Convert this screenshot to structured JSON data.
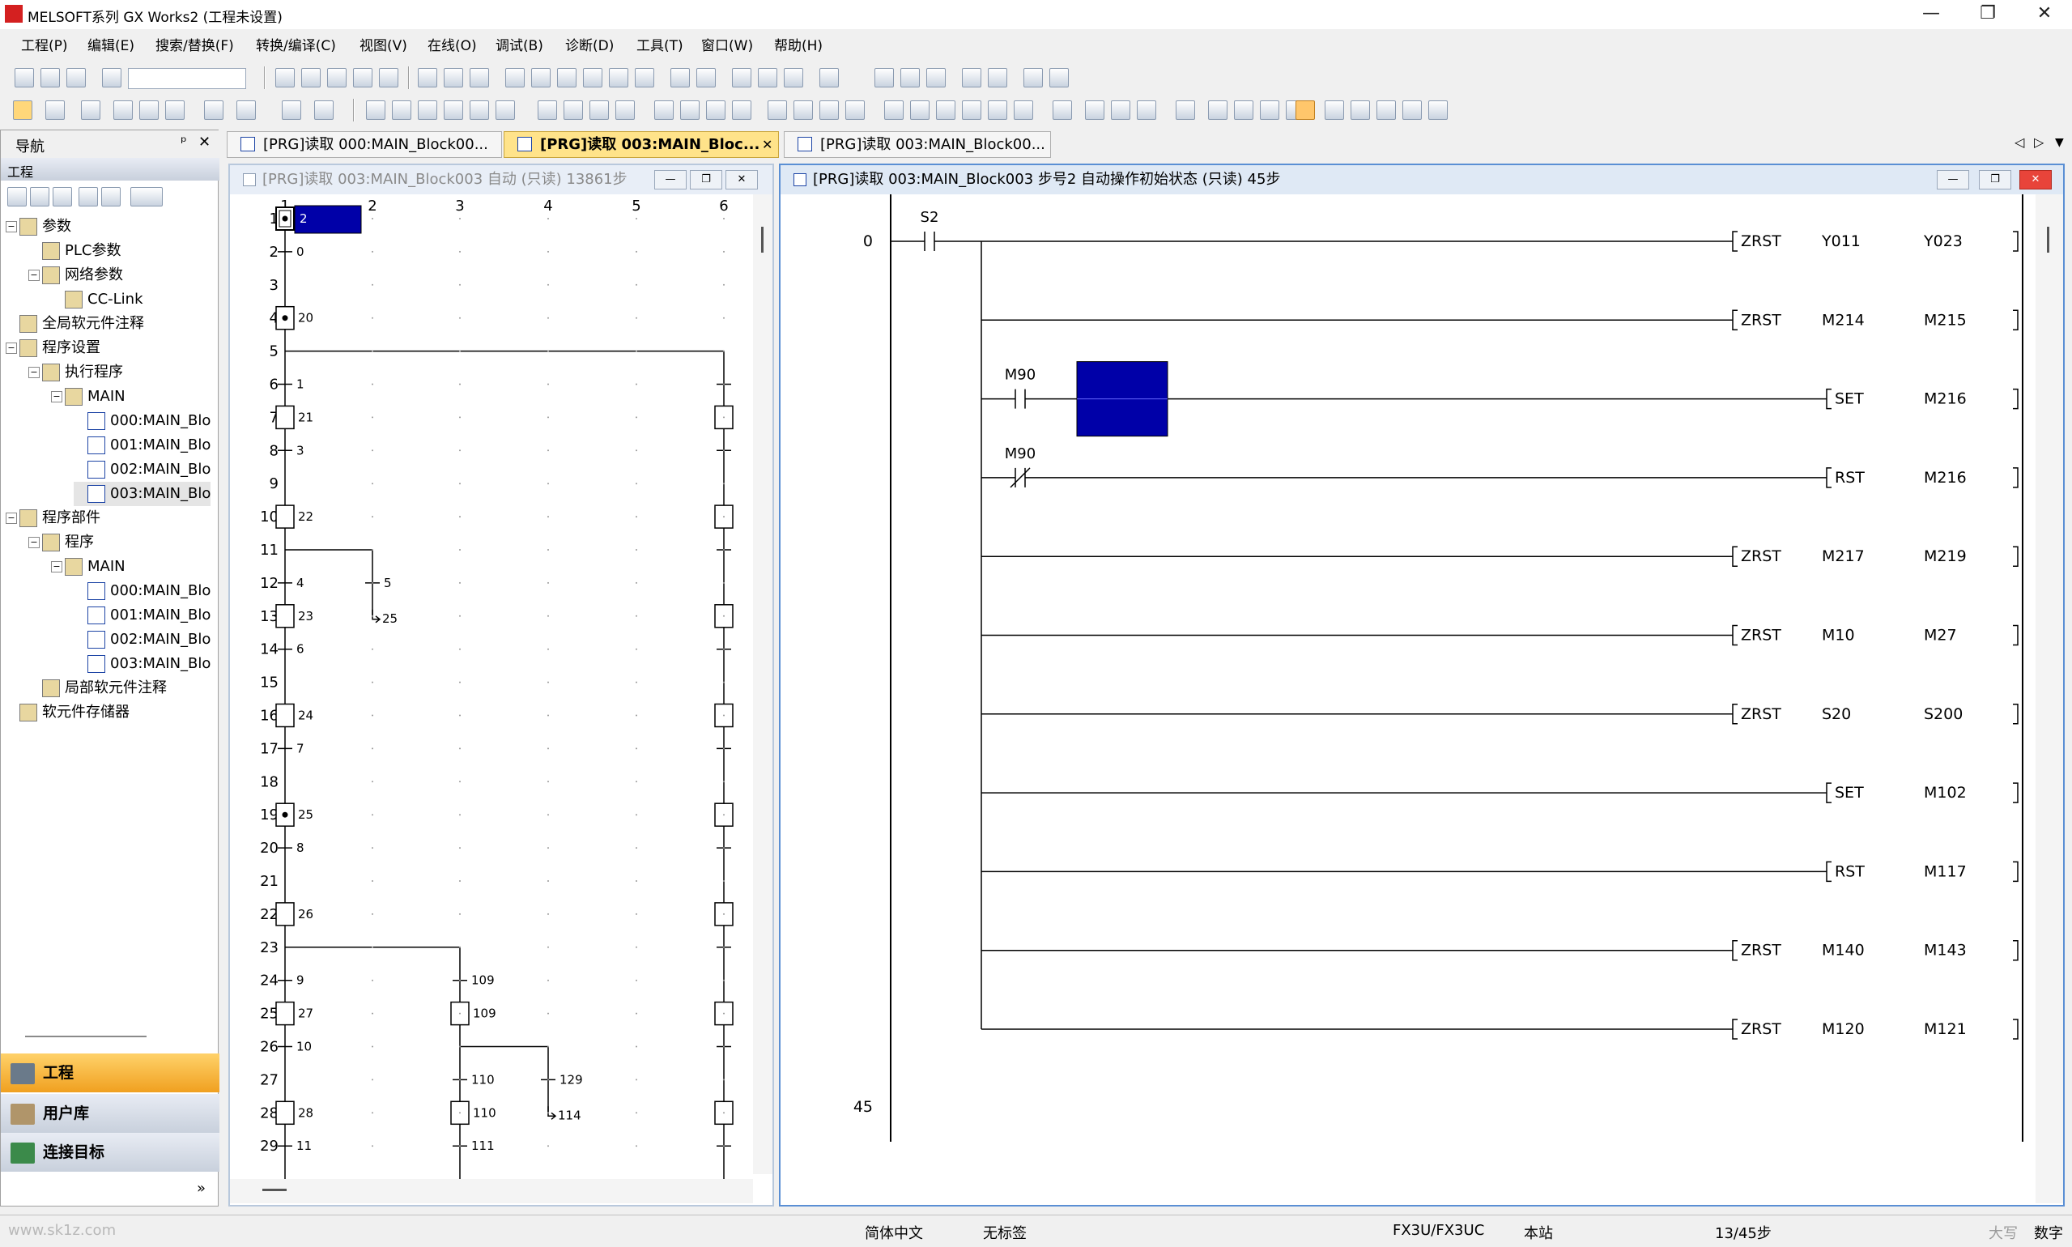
{
  "window": {
    "title": "MELSOFT系列 GX Works2 (工程未设置)",
    "min": "—",
    "max": "❐",
    "close": "✕"
  },
  "menu": [
    "工程(P)",
    "编辑(E)",
    "搜索/替换(F)",
    "转换/编译(C)",
    "视图(V)",
    "在线(O)",
    "调试(B)",
    "诊断(D)",
    "工具(T)",
    "窗口(W)",
    "帮助(H)"
  ],
  "nav": {
    "header": "导航",
    "pin": "ᵖ",
    "close": "✕",
    "section": "工程",
    "tree": [
      {
        "label": "参数",
        "level": 0,
        "exp": "-"
      },
      {
        "label": "PLC参数",
        "level": 1
      },
      {
        "label": "网络参数",
        "level": 1,
        "exp": "-"
      },
      {
        "label": "CC-Link",
        "level": 2
      },
      {
        "label": "全局软元件注释",
        "level": 0
      },
      {
        "label": "程序设置",
        "level": 0,
        "exp": "-"
      },
      {
        "label": "执行程序",
        "level": 1,
        "exp": "-"
      },
      {
        "label": "MAIN",
        "level": 2,
        "exp": "-"
      },
      {
        "label": "000:MAIN_Blo",
        "level": 3,
        "file": true
      },
      {
        "label": "001:MAIN_Blo",
        "level": 3,
        "file": true
      },
      {
        "label": "002:MAIN_Blo",
        "level": 3,
        "file": true
      },
      {
        "label": "003:MAIN_Blo",
        "level": 3,
        "file": true,
        "sel": true
      },
      {
        "label": "程序部件",
        "level": 0,
        "exp": "-"
      },
      {
        "label": "程序",
        "level": 1,
        "exp": "-"
      },
      {
        "label": "MAIN",
        "level": 2,
        "exp": "-"
      },
      {
        "label": "000:MAIN_Blo",
        "level": 3,
        "file": true
      },
      {
        "label": "001:MAIN_Blo",
        "level": 3,
        "file": true
      },
      {
        "label": "002:MAIN_Blo",
        "level": 3,
        "file": true
      },
      {
        "label": "003:MAIN_Blo",
        "level": 3,
        "file": true
      },
      {
        "label": "局部软元件注释",
        "level": 1
      },
      {
        "label": "软元件存储器",
        "level": 0
      }
    ],
    "bottom_tabs": [
      "工程",
      "用户库",
      "连接目标"
    ]
  },
  "tabs": [
    {
      "label": "[PRG]读取 000:MAIN_Block00...",
      "active": false
    },
    {
      "label": "[PRG]读取 003:MAIN_Bloc...",
      "active": true
    },
    {
      "label": "[PRG]读取 003:MAIN_Block00...",
      "active": false
    }
  ],
  "sfc_window": {
    "title": "[PRG]读取 003:MAIN_Block003 自动 (只读) 13861步",
    "columns": [
      "1",
      "2",
      "3",
      "4",
      "5",
      "6"
    ],
    "rows": [
      "1",
      "2",
      "3",
      "4",
      "5",
      "6",
      "7",
      "8",
      "9",
      "10",
      "11",
      "12",
      "13",
      "14",
      "15",
      "16",
      "17",
      "18",
      "19",
      "20",
      "21",
      "22",
      "23",
      "24",
      "25",
      "26",
      "27",
      "28",
      "29"
    ],
    "labels": {
      "r1": "2",
      "r2": "0",
      "r4": "20",
      "r6": "1",
      "r7": "21",
      "r8": "3",
      "r10": "22",
      "r12a": "4",
      "r12b": "5",
      "r13a": "23",
      "r13b": "25",
      "r14": "6",
      "r16": "24",
      "r17": "7",
      "r19": "25",
      "r20": "8",
      "r22": "26",
      "r24a": "9",
      "r24b": "109",
      "r25a": "27",
      "r25b": "109",
      "r26": "10",
      "r27a": "110",
      "r27b": "129",
      "r28a": "28",
      "r28b": "110",
      "r28c": "114",
      "r29a": "11",
      "r29b": "111"
    }
  },
  "ladder_window": {
    "title": "[PRG]读取 003:MAIN_Block003 步号2 自动操作初始状态 (只读) 45步",
    "step_start": "0",
    "step_end": "45",
    "contact_s2": "S2",
    "contact_m90a": "M90",
    "contact_m90b": "M90",
    "rungs": [
      {
        "op": "ZRST",
        "a": "Y011",
        "b": "Y023"
      },
      {
        "op": "ZRST",
        "a": "M214",
        "b": "M215"
      },
      {
        "op": "SET",
        "a": "M216",
        "b": ""
      },
      {
        "op": "RST",
        "a": "M216",
        "b": ""
      },
      {
        "op": "ZRST",
        "a": "M217",
        "b": "M219"
      },
      {
        "op": "ZRST",
        "a": "M10",
        "b": "M27"
      },
      {
        "op": "ZRST",
        "a": "S20",
        "b": "S200"
      },
      {
        "op": "SET",
        "a": "M102",
        "b": ""
      },
      {
        "op": "RST",
        "a": "M117",
        "b": ""
      },
      {
        "op": "ZRST",
        "a": "M140",
        "b": "M143"
      },
      {
        "op": "ZRST",
        "a": "M120",
        "b": "M121"
      }
    ]
  },
  "status": {
    "watermark": "www.sk1z.com",
    "lang": "简体中文",
    "label": "无标签",
    "cpu": "FX3U/FX3UC",
    "station": "本站",
    "step": "13/45步",
    "caps": "大写",
    "num": "数字"
  },
  "colors": {
    "selection": "#0000a8",
    "accent_tab": "#ffe38a",
    "frame": "#5a8fd4"
  }
}
